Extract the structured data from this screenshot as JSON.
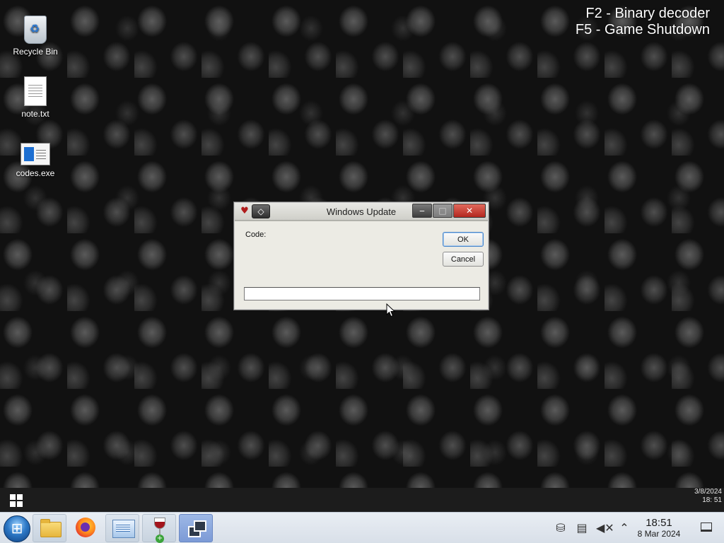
{
  "desktop": {
    "hints": [
      "F2 - Binary decoder",
      "F5 - Game Shutdown"
    ],
    "icons": [
      {
        "label": "Recycle Bin",
        "icon": "recycle-bin-icon"
      },
      {
        "label": "note.txt",
        "icon": "text-file-icon"
      },
      {
        "label": "codes.exe",
        "icon": "executable-icon"
      }
    ]
  },
  "dialog": {
    "title": "Windows Update",
    "code_label": "Code:",
    "ok_label": "OK",
    "cancel_label": "Cancel",
    "code_value": "",
    "titlebar_buttons": {
      "minimize": "‒",
      "restore": "□",
      "close": "✕"
    }
  },
  "topbar": {
    "date": "3/8/2024",
    "time": "18: 51"
  },
  "taskbar": {
    "apps": [
      "file-explorer-icon",
      "firefox-icon",
      "remote-desktop-icon",
      "wine-icon",
      "window-switcher-icon"
    ],
    "clock_time": "18:51",
    "clock_date": "8 Mar 2024",
    "tray": [
      "usb-icon",
      "clipboard-icon",
      "volume-muted-icon",
      "chevron-up-icon"
    ]
  },
  "colors": {
    "close_button": "#c8382c",
    "ok_focus_border": "#4a86c9",
    "taskbar_bg": "#e2e8f0"
  }
}
